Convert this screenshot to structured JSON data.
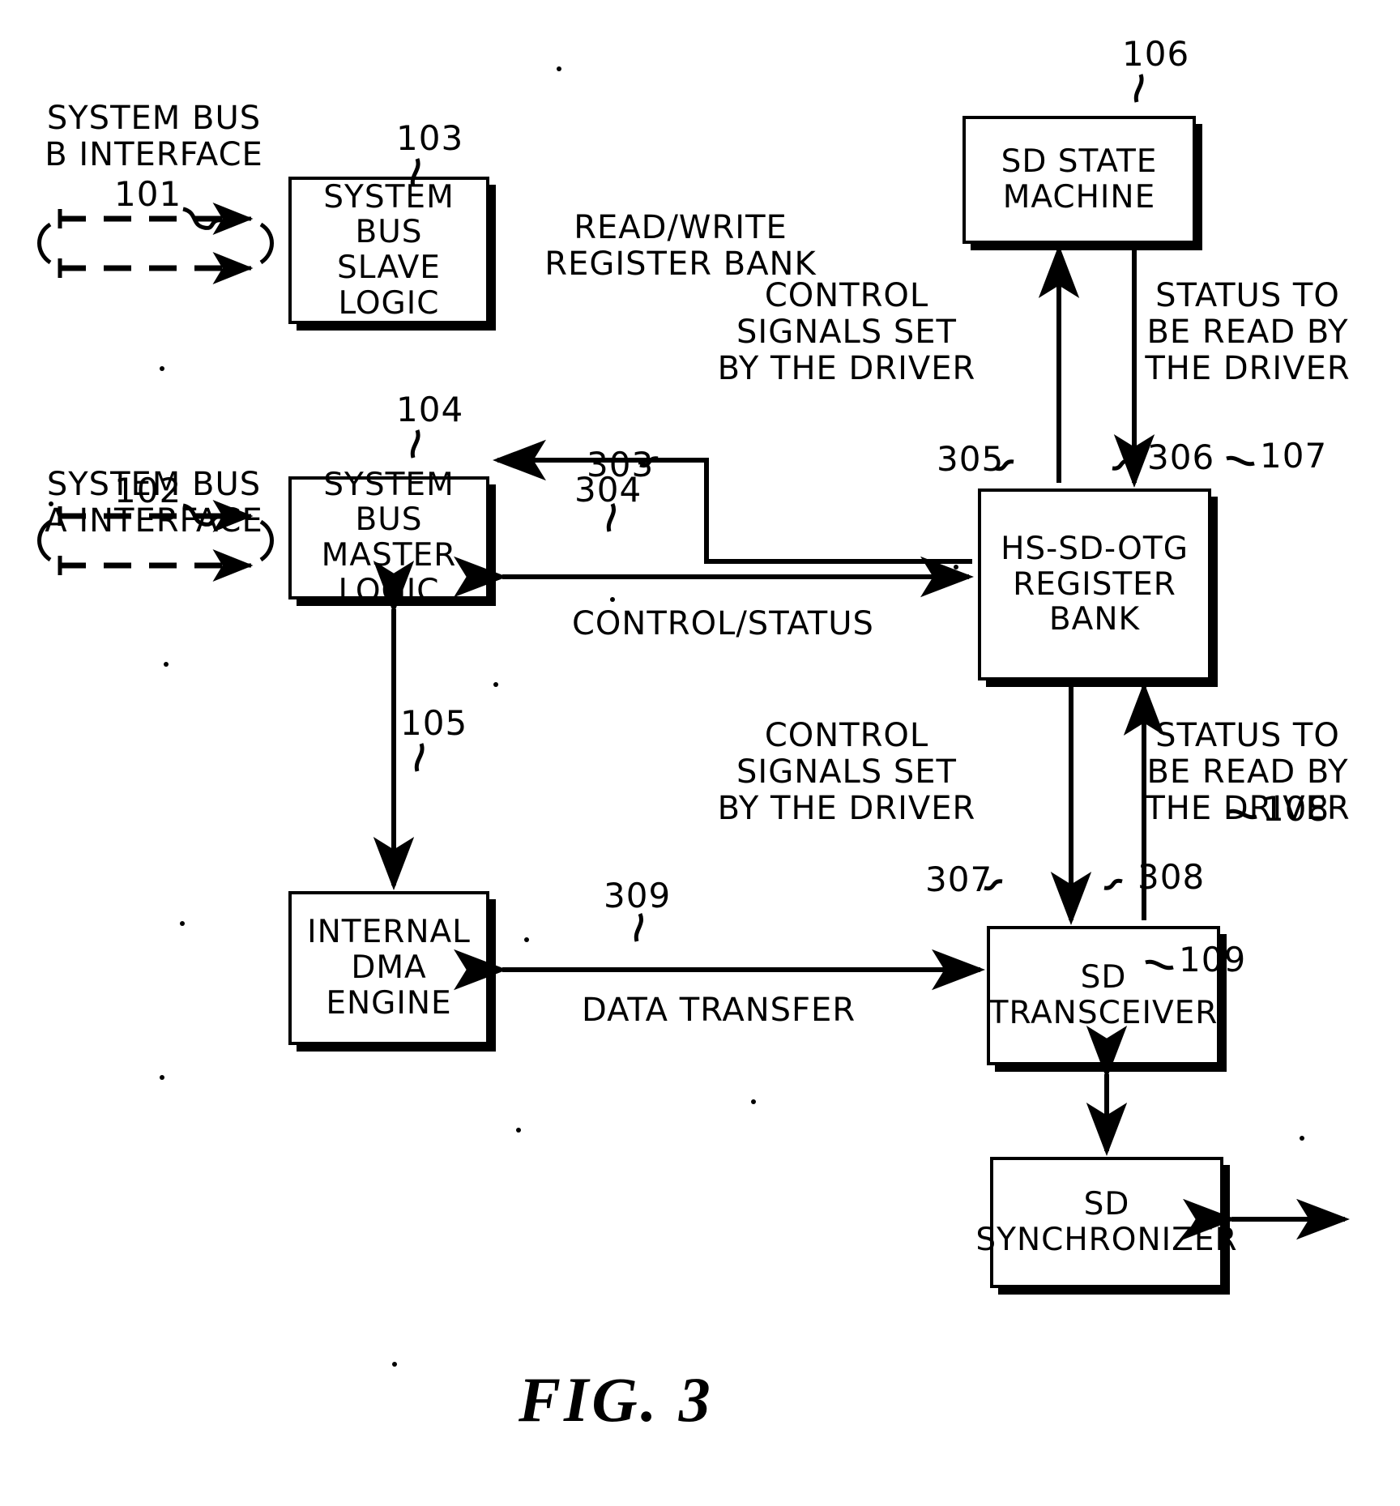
{
  "figure": {
    "caption": "FIG. 3"
  },
  "boxes": [
    {
      "id": "slave_logic",
      "label": "SYSTEM BUS\nSLAVE\nLOGIC",
      "ref": "103"
    },
    {
      "id": "master_logic",
      "label": "SYSTEM BUS\nMASTER\nLOGIC",
      "ref": "104"
    },
    {
      "id": "dma_engine",
      "label": "INTERNAL\nDMA\nENGINE",
      "ref": "105"
    },
    {
      "id": "sd_state",
      "label": "SD STATE\nMACHINE",
      "ref": "106"
    },
    {
      "id": "reg_bank",
      "label": "HS-SD-OTG\nREGISTER\nBANK",
      "ref": "107"
    },
    {
      "id": "sd_transceiver",
      "label": "SD\nTRANSCEIVER",
      "ref": "108"
    },
    {
      "id": "sd_sync",
      "label": "SD\nSYNCHRONIZER",
      "ref": "109"
    }
  ],
  "interfaces": [
    {
      "id": "bus_b",
      "label": "SYSTEM BUS\nB INTERFACE",
      "ref": "101"
    },
    {
      "id": "bus_a",
      "label": "SYSTEM BUS\nA INTERFACE",
      "ref": "102"
    }
  ],
  "connections": [
    {
      "id": "c303",
      "ref": "303",
      "label": "READ/WRITE\nREGISTER BANK"
    },
    {
      "id": "c304",
      "ref": "304",
      "label": "CONTROL/STATUS"
    },
    {
      "id": "c305",
      "ref": "305",
      "label": "CONTROL\nSIGNALS SET\nBY THE DRIVER"
    },
    {
      "id": "c306",
      "ref": "306",
      "label": "STATUS TO\nBE READ BY\nTHE DRIVER"
    },
    {
      "id": "c307",
      "ref": "307",
      "label": "CONTROL\nSIGNALS SET\nBY THE DRIVER"
    },
    {
      "id": "c308",
      "ref": "308",
      "label": "STATUS TO\nBE READ BY\nTHE DRIVER"
    },
    {
      "id": "c309",
      "ref": "309",
      "label": "DATA TRANSFER"
    }
  ]
}
